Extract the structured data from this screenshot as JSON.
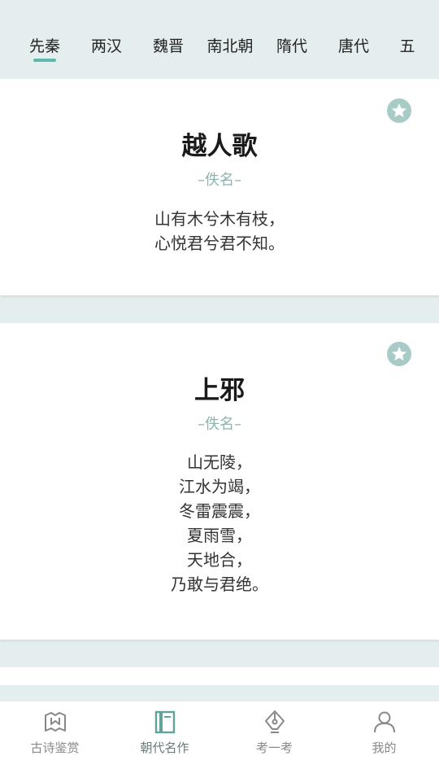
{
  "tabs": [
    {
      "label": "先秦",
      "active": true
    },
    {
      "label": "两汉"
    },
    {
      "label": "魏晋"
    },
    {
      "label": "南北朝"
    },
    {
      "label": "隋代"
    },
    {
      "label": "唐代"
    },
    {
      "label": "五"
    }
  ],
  "poems": [
    {
      "title": "越人歌",
      "author": "–佚名–",
      "lines": [
        "山有木兮木有枝，",
        "心悦君兮君不知。"
      ],
      "favorite_icon": "star-icon"
    },
    {
      "title": "上邪",
      "author": "–佚名–",
      "lines": [
        "山无陵，",
        "江水为竭，",
        "冬雷震震，",
        "夏雨雪，",
        "天地合，",
        "乃敢与君绝。"
      ],
      "favorite_icon": "star-icon"
    }
  ],
  "bottom_nav": [
    {
      "label": "古诗鉴赏",
      "icon": "book-open-icon"
    },
    {
      "label": "朝代名作",
      "icon": "book-icon",
      "active": true
    },
    {
      "label": "考一考",
      "icon": "pen-nib-icon"
    },
    {
      "label": "我的",
      "icon": "person-icon"
    }
  ],
  "colors": {
    "accent": "#5fb8ad",
    "background": "#e5eeee",
    "author": "#8ab5b0",
    "star": "#a9cbc7"
  }
}
